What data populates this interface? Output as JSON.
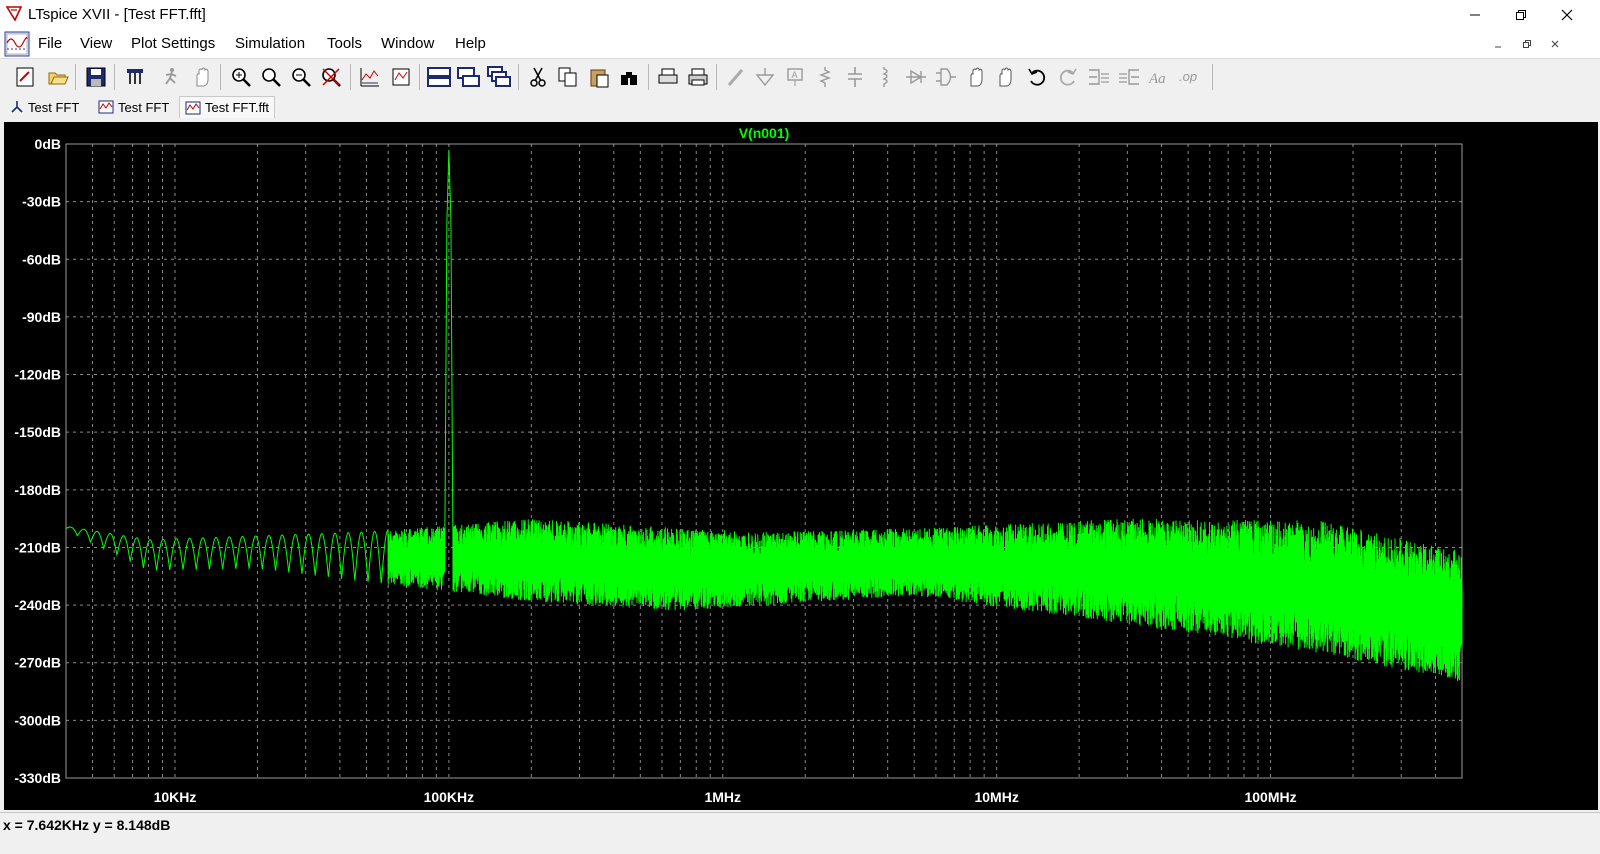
{
  "window": {
    "title": "LTspice XVII - [Test FFT.fft]",
    "controls": [
      "minimize-icon",
      "maximize-icon",
      "close-icon"
    ]
  },
  "menu": {
    "items": [
      {
        "label": "File"
      },
      {
        "label": "View"
      },
      {
        "label": "Plot Settings"
      },
      {
        "label": "Simulation"
      },
      {
        "label": "Tools"
      },
      {
        "label": "Window"
      },
      {
        "label": "Help"
      }
    ]
  },
  "toolbar": {
    "buttons": [
      "new-schematic-icon",
      "open-icon",
      "save-icon",
      "control-panel-icon",
      "run-icon",
      "halt-icon",
      "zoom-in-icon",
      "zoom-full-icon",
      "zoom-out-icon",
      "zoom-cancel-icon",
      "autorange-icon",
      "pick-traces-icon",
      "tile-horizontal-icon",
      "tile-vertical-icon",
      "cascade-icon",
      "cut-icon",
      "copy-icon",
      "paste-icon",
      "find-icon",
      "print-preview-icon",
      "print-icon",
      "wire-icon",
      "ground-icon",
      "label-icon",
      "resistor-icon",
      "capacitor-icon",
      "inductor-icon",
      "diode-icon",
      "component-icon",
      "move-icon",
      "drag-icon",
      "undo-icon",
      "redo-icon",
      "rotate-icon",
      "mirror-icon",
      "text-icon",
      "spice-directive-icon"
    ]
  },
  "tabs": [
    {
      "label": "Test FFT",
      "icon": "schematic-icon",
      "active": false
    },
    {
      "label": "Test FFT",
      "icon": "waveform-icon",
      "active": false
    },
    {
      "label": "Test FFT.fft",
      "icon": "waveform-icon",
      "active": true
    }
  ],
  "status": {
    "readout": "x = 7.642KHz    y = 8.148dB"
  },
  "chart_data": {
    "type": "line",
    "title": "V(n001)",
    "xscale": "log",
    "xlim": [
      4000,
      500000000
    ],
    "ylim": [
      -330,
      0
    ],
    "xticks": [
      {
        "value": 10000,
        "label": "10KHz"
      },
      {
        "value": 100000,
        "label": "100KHz"
      },
      {
        "value": 1000000,
        "label": "1MHz"
      },
      {
        "value": 10000000,
        "label": "10MHz"
      },
      {
        "value": 100000000,
        "label": "100MHz"
      }
    ],
    "yticks": [
      {
        "value": 0,
        "label": "0dB"
      },
      {
        "value": -30,
        "label": "-30dB"
      },
      {
        "value": -60,
        "label": "-60dB"
      },
      {
        "value": -90,
        "label": "-90dB"
      },
      {
        "value": -120,
        "label": "-120dB"
      },
      {
        "value": -150,
        "label": "-150dB"
      },
      {
        "value": -180,
        "label": "-180dB"
      },
      {
        "value": -210,
        "label": "-210dB"
      },
      {
        "value": -240,
        "label": "-240dB"
      },
      {
        "value": -270,
        "label": "-270dB"
      },
      {
        "value": -300,
        "label": "-300dB"
      },
      {
        "value": -330,
        "label": "-330dB"
      }
    ],
    "grid": true,
    "series": [
      {
        "name": "V(n001)",
        "color": "#00ff00",
        "peak": {
          "x": 100000,
          "y": -3
        },
        "envelope": [
          {
            "x": 4000,
            "upper": -199,
            "lower": -201
          },
          {
            "x": 8000,
            "upper": -206,
            "lower": -222
          },
          {
            "x": 20000,
            "upper": -204,
            "lower": -221
          },
          {
            "x": 50000,
            "upper": -202,
            "lower": -228
          },
          {
            "x": 200000,
            "upper": -195,
            "lower": -238
          },
          {
            "x": 700000,
            "upper": -200,
            "lower": -243
          },
          {
            "x": 1500000,
            "upper": -202,
            "lower": -240
          },
          {
            "x": 5000000,
            "upper": -200,
            "lower": -235
          },
          {
            "x": 30000000,
            "upper": -195,
            "lower": -250
          },
          {
            "x": 150000000,
            "upper": -196,
            "lower": -265
          },
          {
            "x": 500000000,
            "upper": -212,
            "lower": -280
          }
        ]
      }
    ]
  },
  "colors": {
    "plot_background": "#000000",
    "grid": "#8a8a8a",
    "trace": "#00ff00",
    "axis_label": "#ffffff"
  }
}
